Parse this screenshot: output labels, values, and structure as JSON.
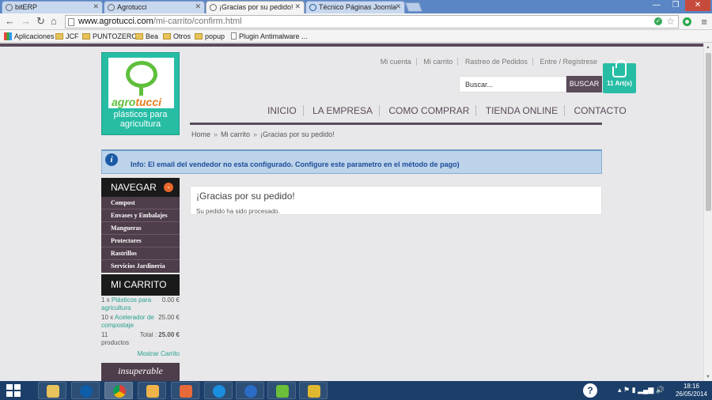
{
  "browser": {
    "tabs": [
      {
        "label": "bitERP"
      },
      {
        "label": "Agrotucci"
      },
      {
        "label": "¡Gracias por su pedido!"
      },
      {
        "label": "Técnico Páginas Joomla"
      }
    ],
    "url_domain": "www.agrotucci.com",
    "url_path": "/mi-carrito/confirm.html",
    "bookmarks": [
      "Aplicaciones",
      "JCF",
      "PUNTOZERO",
      "Bea",
      "Otros",
      "popup",
      "Plugin Antimalware ..."
    ]
  },
  "site": {
    "logo_name_a": "agro",
    "logo_name_b": "tucci",
    "logo_tagline": "plásticos para agricultura",
    "top_links": [
      "Mi cuenta",
      "Mi carrito",
      "Rastreo de Pedidos",
      "Entre / Regístrese"
    ],
    "search_placeholder": "Buscar...",
    "search_button": "BUSCAR",
    "cart_count": "11 Art(s)",
    "nav": [
      "INICIO",
      "LA EMPRESA",
      "COMO COMPRAR",
      "TIENDA ONLINE",
      "CONTACTO"
    ],
    "breadcrumb": [
      "Home",
      "Mi carrito",
      "¡Gracias por su pedido!"
    ],
    "breadcrumb_sep": "»",
    "info_message": "Info: El email del vendedor no esta configurado. Configure este parametro en el método de pago)"
  },
  "sidebar": {
    "nav_title": "NAVEGAR",
    "nav_items": [
      "Compost",
      "Envases y Embalajes",
      "Mangueras",
      "Protectores",
      "Rastrillos",
      "Servicios Jardinería"
    ],
    "cart_title": "MI CARRITO",
    "cart_items": [
      {
        "qty": "1 x",
        "name": "Plásticos para agricultura",
        "price": "0.00 €"
      },
      {
        "qty": "10 x",
        "name": "Acelerador de compostaje",
        "price": "25.00 €"
      }
    ],
    "cart_total_count": "11 productos",
    "cart_total_label": "Total :",
    "cart_total_value": "25.00 €",
    "cart_show": "Mostrar Carrito",
    "banner": "insuperable"
  },
  "content": {
    "heading": "¡Gracias por su pedido!",
    "message": "Su pedido ha sido procesado."
  },
  "taskbar": {
    "time": "18:16",
    "date": "26/05/2014"
  }
}
